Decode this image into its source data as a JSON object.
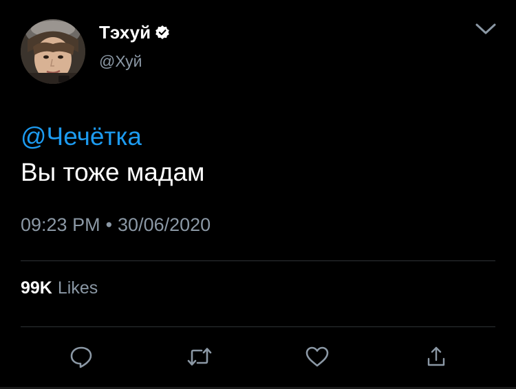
{
  "author": {
    "name": "Тэхуй",
    "handle": "@Хуй",
    "verified": true
  },
  "tweet": {
    "mention": "@Чечётка",
    "text": "Вы тоже мадам",
    "time": "09:23 PM",
    "separator": "•",
    "date": "30/06/2020"
  },
  "stats": {
    "likes_count": "99K",
    "likes_label": "Likes"
  },
  "actions": {
    "reply": "reply-icon",
    "retweet": "retweet-icon",
    "like": "heart-icon",
    "share": "share-icon"
  },
  "colors": {
    "background": "#000000",
    "text": "#ffffff",
    "secondary": "#8b98a5",
    "accent": "#1d9bf0",
    "divider": "#2f3336"
  }
}
